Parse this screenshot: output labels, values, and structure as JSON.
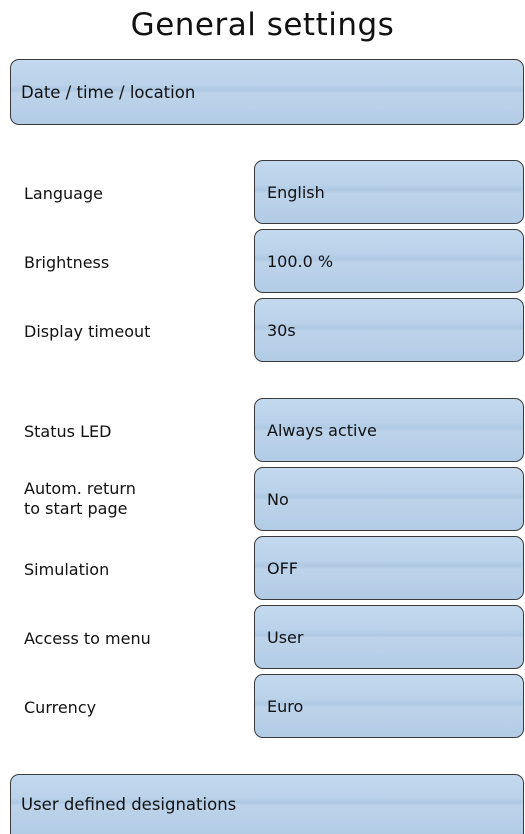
{
  "page": {
    "title": "General settings"
  },
  "sections": {
    "date_time_location": "Date / time / location",
    "user_designations": "User defined designations"
  },
  "settings": [
    {
      "label": "Language",
      "value": "English"
    },
    {
      "label": "Brightness",
      "value": "100.0 %"
    },
    {
      "label": "Display timeout",
      "value": "30s"
    },
    {
      "label": "Status LED",
      "value": "Always active"
    },
    {
      "label": "Autom. return\nto start page",
      "value": "No"
    },
    {
      "label": "Simulation",
      "value": "OFF"
    },
    {
      "label": "Access to menu",
      "value": "User"
    },
    {
      "label": "Currency",
      "value": "Euro"
    }
  ],
  "colors": {
    "button_fill": "#b8d0e8",
    "button_border": "#3a3a3a",
    "background": "#ffffff"
  }
}
